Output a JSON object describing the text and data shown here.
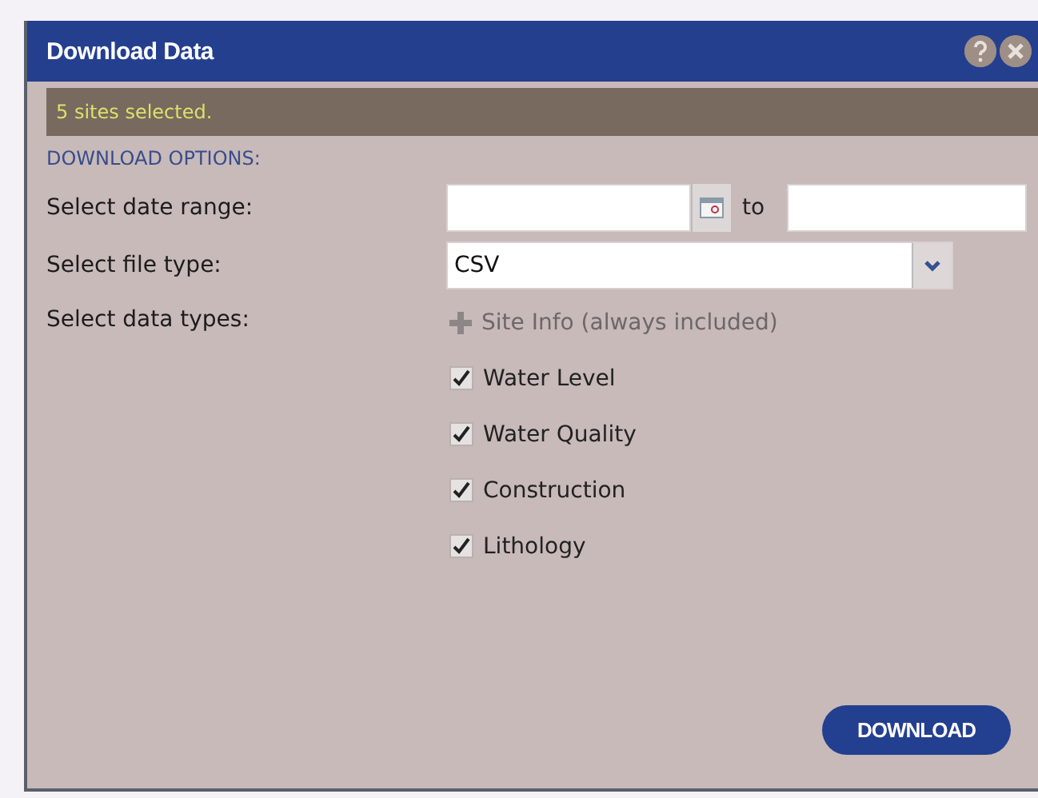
{
  "window": {
    "title": "Download Data"
  },
  "status": "5 sites selected.",
  "section_heading": "DOWNLOAD OPTIONS:",
  "date_range": {
    "label": "Select date range:",
    "separator": "to"
  },
  "file_type": {
    "label": "Select file type:",
    "value": "CSV"
  },
  "data_types": {
    "label": "Select data types:",
    "items": [
      {
        "kind": "fixed",
        "label": "Site Info (always included)"
      },
      {
        "kind": "checkbox",
        "label": "Water Level",
        "checked": true
      },
      {
        "kind": "checkbox",
        "label": "Water Quality",
        "checked": true
      },
      {
        "kind": "checkbox",
        "label": "Construction",
        "checked": true
      },
      {
        "kind": "checkbox",
        "label": "Lithology",
        "checked": true
      }
    ]
  },
  "buttons": [
    "DOWNLOAD"
  ]
}
